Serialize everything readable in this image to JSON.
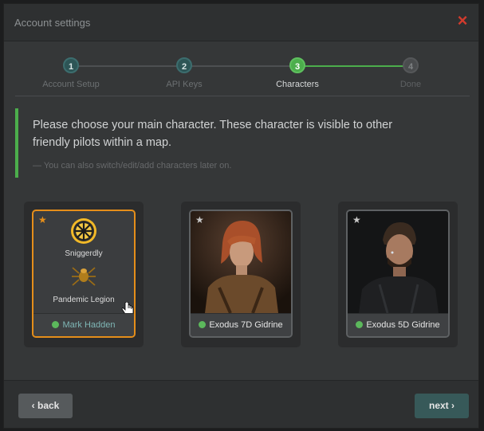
{
  "dialog": {
    "title": "Account settings",
    "close_icon": "close-icon"
  },
  "wizard": {
    "steps": [
      {
        "number": "1",
        "label": "Account Setup",
        "state": "done"
      },
      {
        "number": "2",
        "label": "API Keys",
        "state": "done"
      },
      {
        "number": "3",
        "label": "Characters",
        "state": "active"
      },
      {
        "number": "4",
        "label": "Done",
        "state": "pending"
      }
    ]
  },
  "callout": {
    "text": "Please choose your main character. These character is visible to other friendly pilots within a map.",
    "note": "— You can also switch/edit/add characters later on."
  },
  "characters": [
    {
      "name": "Mark Hadden",
      "corporation": "Sniggerdly",
      "alliance": "Pandemic Legion",
      "main": true,
      "online": true
    },
    {
      "name": "Exodus 7D Gidrine",
      "main": false,
      "online": true
    },
    {
      "name": "Exodus 5D Gidrine",
      "main": false,
      "online": true
    }
  ],
  "buttons": {
    "back": "‹ back",
    "next": "next ›"
  },
  "colors": {
    "accent_green": "#5cb85c",
    "main_border": "#e58e1a",
    "close": "#d23b2d",
    "next_button": "#375959"
  }
}
